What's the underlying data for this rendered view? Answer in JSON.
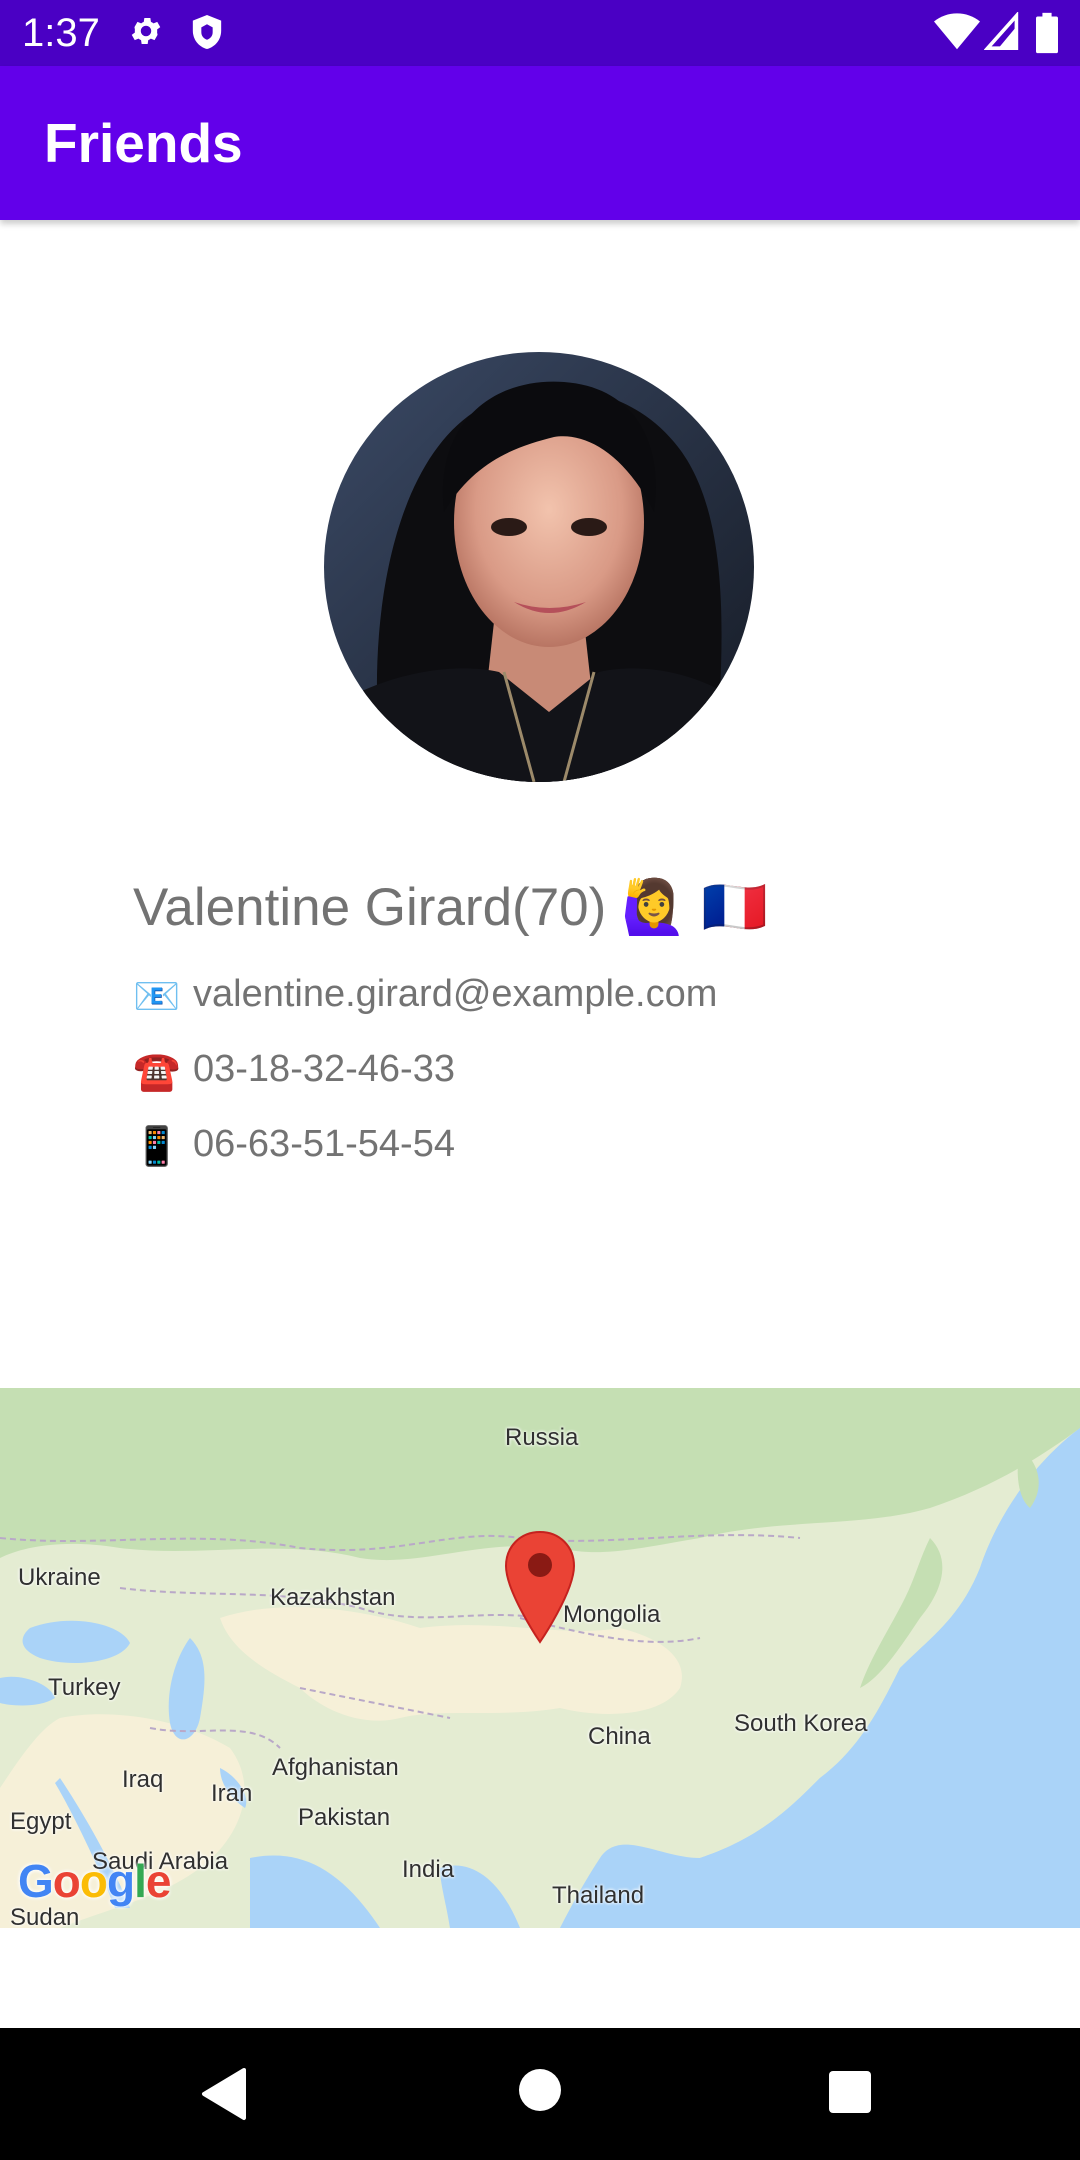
{
  "status_bar": {
    "time": "1:37",
    "left_icons": [
      "gear-icon",
      "shield-icon"
    ],
    "right_icons": [
      "wifi-icon",
      "cellular-signal-icon",
      "battery-icon"
    ]
  },
  "app_bar": {
    "title": "Friends",
    "color": "#6200ea",
    "status_color": "#4a00c4"
  },
  "profile": {
    "name_age": "Valentine Girard(70)",
    "name_emoji": "🙋‍♀️",
    "flag_emoji": "🇫🇷",
    "email_icon": "📧",
    "email": "valentine.girard@example.com",
    "phone_icon": "☎️",
    "phone": "03-18-32-46-33",
    "cell_icon": "📱",
    "cell": "06-63-51-54-54",
    "text_color": "#737373"
  },
  "map": {
    "labels": {
      "russia": "Russia",
      "ukraine": "Ukraine",
      "kazakhstan": "Kazakhstan",
      "mongolia": "Mongolia",
      "turkey": "Turkey",
      "china": "China",
      "south_korea": "South Korea",
      "afghanistan": "Afghanistan",
      "iraq": "Iraq",
      "iran": "Iran",
      "pakistan": "Pakistan",
      "egypt": "Egypt",
      "saudi_arabia": "Saudi Arabia",
      "india": "India",
      "sudan": "Sudan",
      "thailand": "Thailand"
    },
    "marker_icon": "map-pin-icon",
    "google_logo": "Google",
    "colors": {
      "water": "#aad3f8",
      "land": "#e4ecd2",
      "desert": "#f6f0d8",
      "forest": "#c5dfb3",
      "marker": "#ea4335"
    }
  },
  "nav_bar": {
    "buttons": [
      "back-icon",
      "home-icon",
      "recents-icon"
    ]
  }
}
